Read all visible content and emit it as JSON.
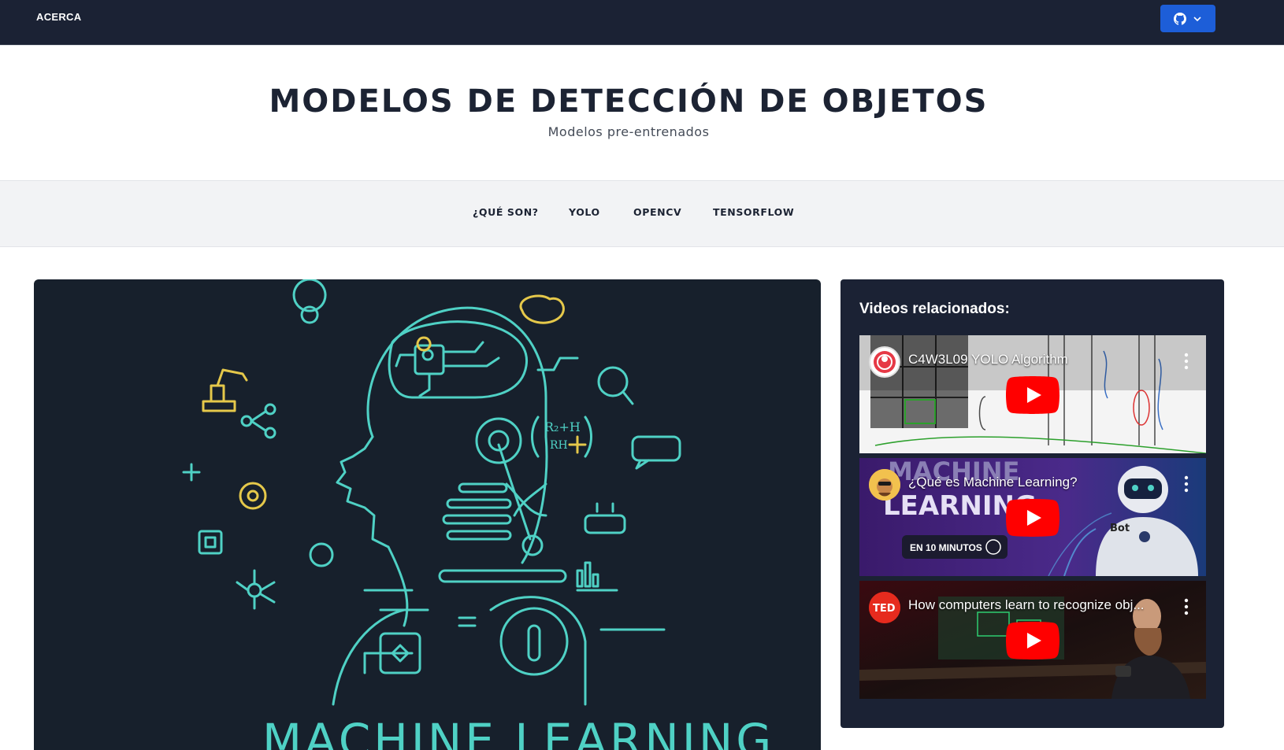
{
  "topbar": {
    "about_label": "ACERCA",
    "github_icon": "github-icon",
    "dropdown_icon": "chevron-down-icon"
  },
  "header": {
    "title": "MODELOS DE DETECCIÓN DE OBJETOS",
    "subtitle": "Modelos pre-entrenados"
  },
  "nav": {
    "items": [
      {
        "label": "¿QUÉ SON?"
      },
      {
        "label": "YOLO"
      },
      {
        "label": "OPENCV"
      },
      {
        "label": "TENSORFLOW"
      }
    ]
  },
  "hero": {
    "caption": "MACHINE LEARNING",
    "accent": "#4fd1c5",
    "secondary": "#e5c84a"
  },
  "sidebar": {
    "heading": "Videos relacionados:",
    "videos": [
      {
        "title": "C4W3L09 YOLO Algorithm",
        "channel_icon": "deeplearning-channel-icon"
      },
      {
        "title": "¿Qué es Machine Learning?",
        "channel_icon": "channel-avatar-icon",
        "badge_text": "EN 10 MINUTOS",
        "overlay_title_1": "MACHINE",
        "overlay_title_2": "LEARNING",
        "robot_label": "Bot"
      },
      {
        "title": "How computers learn to recognize obj...",
        "channel_icon": "ted-icon",
        "channel_label": "TED"
      }
    ]
  },
  "colors": {
    "dark": "#1b2234",
    "github_button": "#1d5ed8",
    "youtube_red": "#ff0000"
  }
}
